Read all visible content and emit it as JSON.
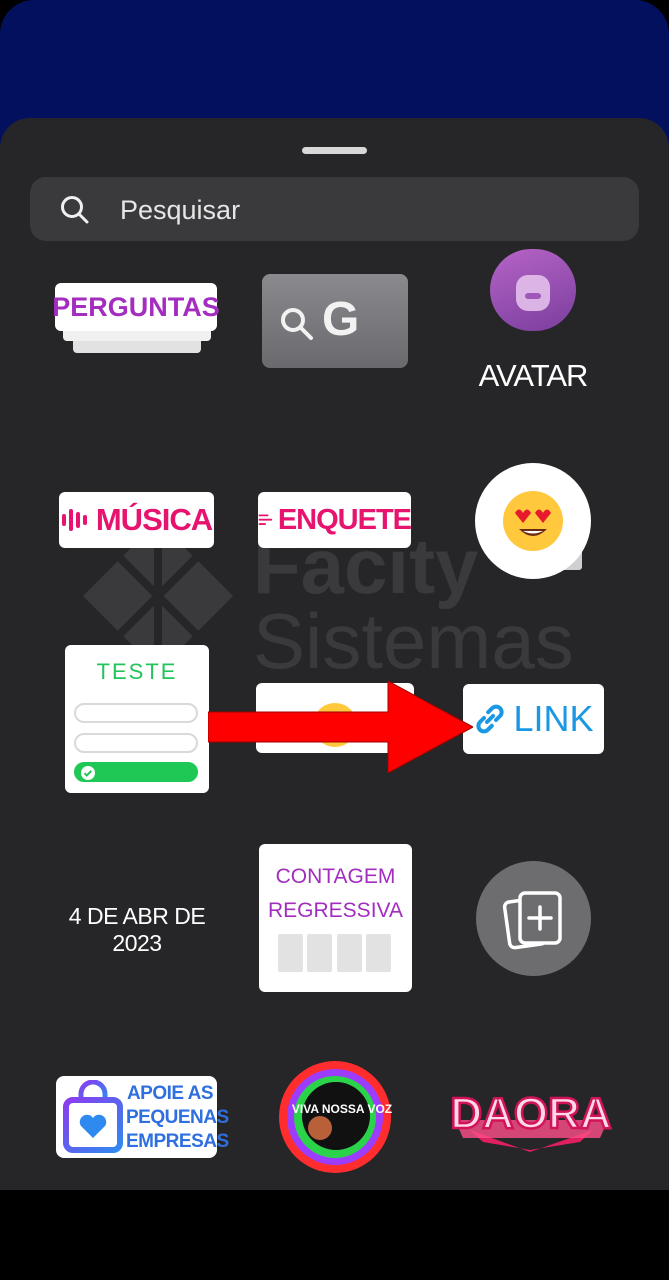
{
  "search": {
    "placeholder": "Pesquisar"
  },
  "stickers": {
    "perguntas": "PERGUNTAS",
    "gif_letter": "G",
    "avatar": "AVATAR",
    "musica": "MÚSICA",
    "enquete": "ENQUETE",
    "teste": "TESTE",
    "link": "LINK",
    "date": "4 DE ABR DE 2023",
    "contagem_line1": "CONTAGEM",
    "contagem_line2": "REGRESSIVA",
    "apoie_line1": "APOIE AS",
    "apoie_line2": "PEQUENAS",
    "apoie_line3": "EMPRESAS",
    "viva": "VIVA NOSSA VOZ",
    "daora": "DAORA"
  },
  "watermark": {
    "line1": "Facity",
    "line2": "Sistemas"
  },
  "colors": {
    "sheet": "#262628",
    "top": "#02105e",
    "accent_pink": "#e6146e",
    "accent_purple": "#a32dbf",
    "link_blue": "#1b98e4",
    "quiz_green": "#24c45d",
    "arrow_red": "#ff0000"
  }
}
